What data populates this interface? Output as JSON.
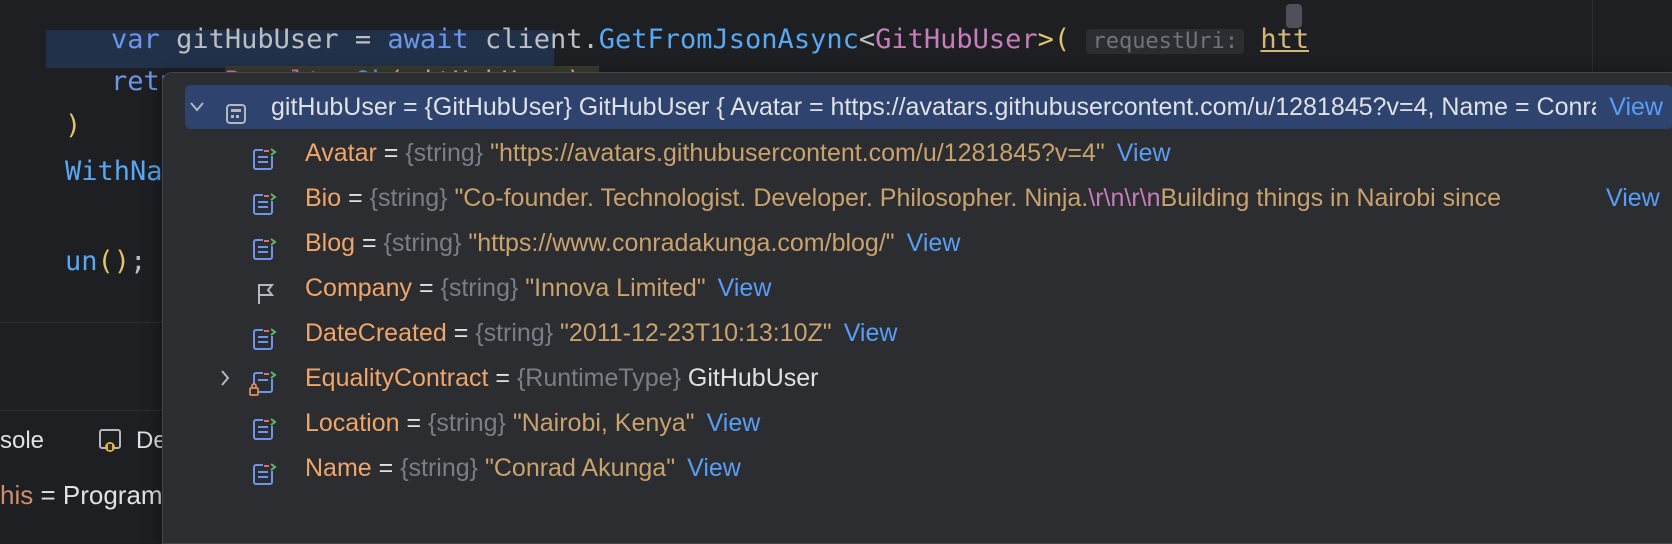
{
  "editor": {
    "line0": {
      "prefix_kw": "var ",
      "var_name": "gitHubUser",
      "assign": " = ",
      "await_kw": "await ",
      "client": "client.",
      "method": "GetFromJsonAsync",
      "lt": "<",
      "type": "GitHubUser",
      "gt": ">(",
      "hint": "requestUri:",
      "url": "https:"
    },
    "line1": {
      "return_kw": "return ",
      "results": "Results",
      "dot": ".",
      "ok": "Ok",
      "open": "(",
      "arg": "gitHubUser",
      "close": ")",
      "semi": ";"
    },
    "line2": {
      "text": ")"
    },
    "line3": {
      "method": "WithName",
      "open": "(\""
    },
    "line4": {
      "method": "un",
      "parens": "()",
      "semi": ";"
    }
  },
  "toolwindow": {
    "console_tab": "sole",
    "debug_tab": "De",
    "this_prefix": "his",
    "this_value": " = Program"
  },
  "debugger_popup": {
    "root": {
      "name": "gitHubUser",
      "text": "gitHubUser = {GitHubUser} GitHubUser { Avatar = https://avatars.githubusercontent.com/u/1281845?v=4, Name = Conrad Akunga }",
      "view": "View"
    },
    "fields": [
      {
        "name": "Avatar",
        "type": "{string}",
        "value": "\"https://avatars.githubusercontent.com/u/1281845?v=4\"",
        "view": "View",
        "icon": "field-icon"
      },
      {
        "name": "Bio",
        "type": "{string}",
        "value_a": "\"Co-founder. Technologist. Developer. Philosopher. Ninja.",
        "esc": "\\r\\n\\r\\n",
        "value_b": "Building things in Nairobi since",
        "view": "View",
        "icon": "field-icon"
      },
      {
        "name": "Blog",
        "type": "{string}",
        "value": "\"https://www.conradakunga.com/blog/\"",
        "view": "View",
        "icon": "field-icon"
      },
      {
        "name": "Company",
        "type": "{string}",
        "value": "\"Innova Limited\"",
        "view": "View",
        "icon": "flag-icon"
      },
      {
        "name": "DateCreated",
        "type": "{string}",
        "value": "\"2011-12-23T10:13:10Z\"",
        "view": "View",
        "icon": "field-icon"
      },
      {
        "name": "EqualityContract",
        "type": "{RuntimeType}",
        "value": "GitHubUser",
        "icon": "protected-field-icon"
      },
      {
        "name": "Location",
        "type": "{string}",
        "value": "\"Nairobi, Kenya\"",
        "view": "View",
        "icon": "field-icon"
      },
      {
        "name": "Name",
        "type": "{string}",
        "value": "\"Conrad Akunga\"",
        "view": "View",
        "icon": "field-icon"
      }
    ]
  },
  "colors": {
    "editor_bg": "#1e1f22",
    "popup_bg": "#2b2d30",
    "selection": "#2e436e",
    "field_name": "#f0a56a",
    "string": "#c9a26d",
    "link": "#589df6"
  }
}
